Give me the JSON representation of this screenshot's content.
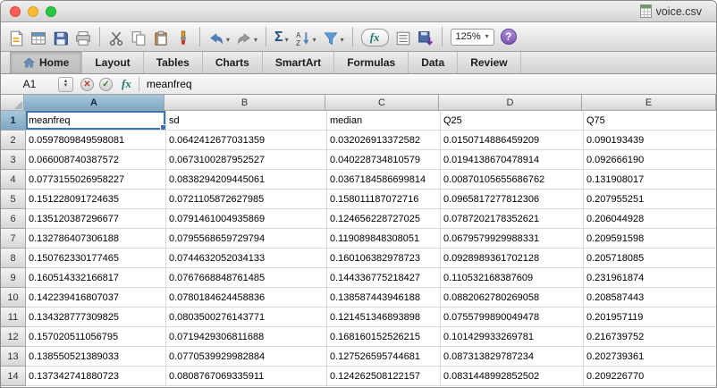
{
  "window": {
    "title": "voice.csv"
  },
  "toolbar": {
    "zoom": "125%",
    "sum_label": "Σ",
    "sort_a": "A",
    "sort_z": "Z",
    "fx_label": "fx",
    "help_label": "?",
    "dropdown_glyph": "▾"
  },
  "ribbon": {
    "tabs": [
      "Home",
      "Layout",
      "Tables",
      "Charts",
      "SmartArt",
      "Formulas",
      "Data",
      "Review"
    ]
  },
  "formula_bar": {
    "cell_ref": "A1",
    "cancel_glyph": "✕",
    "accept_glyph": "✓",
    "fx_label": "fx",
    "value": "meanfreq"
  },
  "grid": {
    "selection": {
      "cell": "A1",
      "col": "A",
      "row": 1
    },
    "column_headers": [
      "A",
      "B",
      "C",
      "D",
      "E"
    ],
    "rows": [
      [
        "meanfreq",
        "sd",
        "median",
        "Q25",
        "Q75"
      ],
      [
        "0.0597809849598081",
        "0.0642412677031359",
        "0.032026913372582",
        "0.0150714886459209",
        "0.090193439"
      ],
      [
        "0.066008740387572",
        "0.0673100287952527",
        "0.040228734810579",
        "0.0194138670478914",
        "0.092666190"
      ],
      [
        "0.0773155026958227",
        "0.0838294209445061",
        "0.0367184586699814",
        "0.00870105655686762",
        "0.131908017"
      ],
      [
        "0.151228091724635",
        "0.0721105872627985",
        "0.158011187072716",
        "0.0965817277812306",
        "0.207955251"
      ],
      [
        "0.135120387296677",
        "0.0791461004935869",
        "0.124656228727025",
        "0.0787202178352621",
        "0.206044928"
      ],
      [
        "0.132786407306188",
        "0.0795568659729794",
        "0.119089848308051",
        "0.0679579929988331",
        "0.209591598"
      ],
      [
        "0.150762330177465",
        "0.0744632052034133",
        "0.160106382978723",
        "0.0928989361702128",
        "0.205718085"
      ],
      [
        "0.160514332166817",
        "0.0767668848761485",
        "0.144336775218427",
        "0.110532168387609",
        "0.231961874"
      ],
      [
        "0.142239416807037",
        "0.0780184624458836",
        "0.138587443946188",
        "0.0882062780269058",
        "0.208587443"
      ],
      [
        "0.134328777309825",
        "0.0803500276143771",
        "0.121451346893898",
        "0.0755799890049478",
        "0.201957119"
      ],
      [
        "0.157020511056795",
        "0.0719429306811688",
        "0.168160152526215",
        "0.101429933269781",
        "0.216739752"
      ],
      [
        "0.138550521389033",
        "0.0770539929982884",
        "0.127526595744681",
        "0.087313829787234",
        "0.202739361"
      ],
      [
        "0.137342741880723",
        "0.0808767069335911",
        "0.124262508122157",
        "0.0831448992852502",
        "0.209226770"
      ]
    ]
  },
  "colors": {
    "selection_border": "#3a76b5",
    "header_selected": "#7ea7c4",
    "help_purple": "#7a55b5"
  }
}
